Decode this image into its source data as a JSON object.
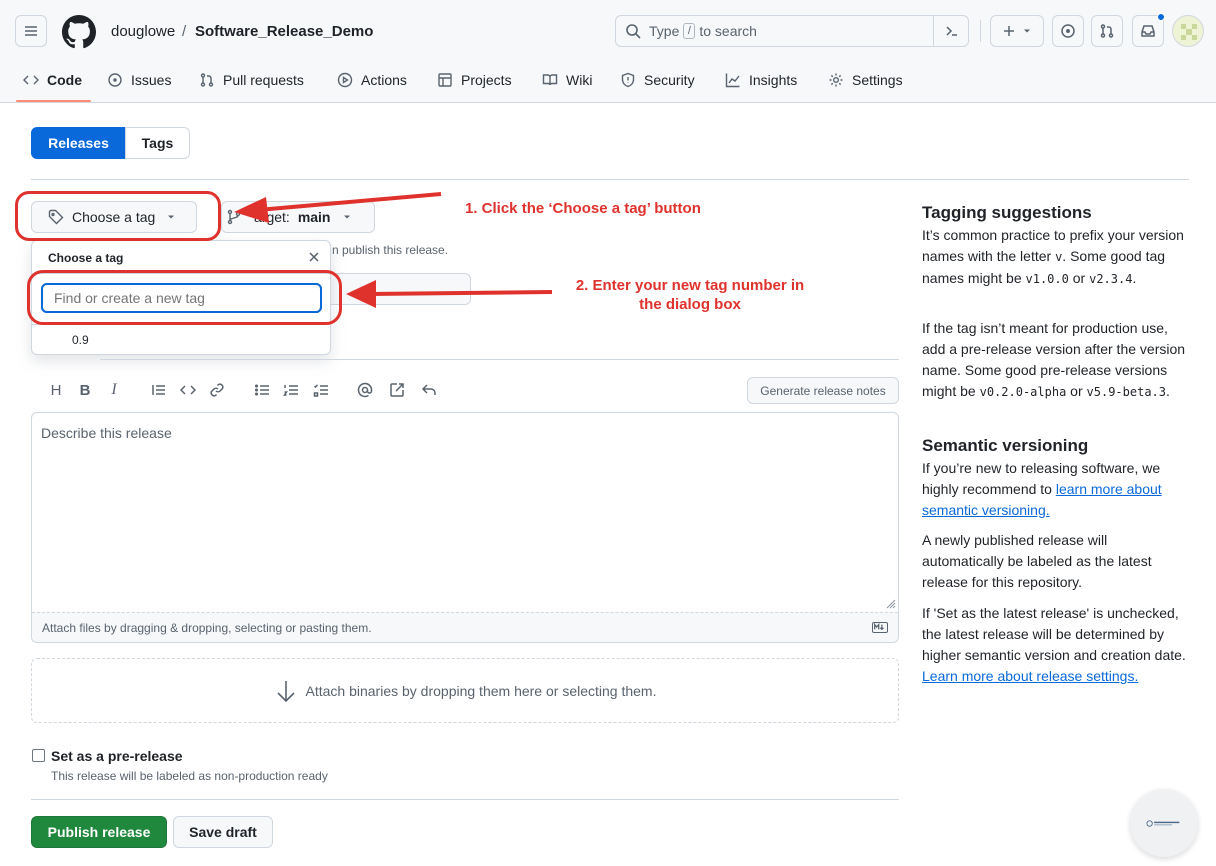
{
  "header": {
    "owner": "douglowe",
    "separator": "/",
    "repo": "Software_Release_Demo",
    "search": {
      "prefix": "Type",
      "slash": "/",
      "suffix": "to search"
    }
  },
  "nav": {
    "items": [
      {
        "label": "Code",
        "icon": "code-icon"
      },
      {
        "label": "Issues",
        "icon": "issue-icon"
      },
      {
        "label": "Pull requests",
        "icon": "pull-request-icon"
      },
      {
        "label": "Actions",
        "icon": "play-icon"
      },
      {
        "label": "Projects",
        "icon": "table-icon"
      },
      {
        "label": "Wiki",
        "icon": "book-icon"
      },
      {
        "label": "Security",
        "icon": "shield-icon"
      },
      {
        "label": "Insights",
        "icon": "graph-icon"
      },
      {
        "label": "Settings",
        "icon": "gear-icon"
      }
    ]
  },
  "tabs": {
    "releases": "Releases",
    "tags": "Tags"
  },
  "tag_button": {
    "label": "Choose a tag"
  },
  "target_button": {
    "label": "arget:",
    "branch": "main"
  },
  "hint_text": "n publish this release.",
  "dropdown": {
    "title": "Choose a tag",
    "placeholder": "Find or create a new tag",
    "options": [
      "0.9"
    ]
  },
  "annotations": {
    "step1": "1. Click the ‘Choose a tag’ button",
    "step2_line1": "2. Enter your new tag number in",
    "step2_line2": "the dialog box"
  },
  "editor": {
    "generate_notes": "Generate release notes",
    "placeholder": "Describe this release",
    "attach_hint": "Attach files by dragging & dropping, selecting or pasting them."
  },
  "binaries": {
    "text": "Attach binaries by dropping them here or selecting them."
  },
  "prerelease": {
    "label": "Set as a pre-release",
    "hint": "This release will be labeled as non-production ready"
  },
  "actions": {
    "publish": "Publish release",
    "draft": "Save draft"
  },
  "sidebar": {
    "tagging_title": "Tagging suggestions",
    "tagging_p1_a": "It’s common practice to prefix your version names with the letter ",
    "tagging_p1_v": "v",
    "tagging_p1_b": ". Some good tag names might be ",
    "tagging_p1_c1": "v1.0.0",
    "tagging_p1_or": " or ",
    "tagging_p1_c2": "v2.3.4",
    "tagging_p1_end": ".",
    "tagging_p2_a": "If the tag isn’t meant for production use, add a pre-release version after the version name. Some good pre-release versions might be ",
    "tagging_p2_c1": "v0.2.0-alpha",
    "tagging_p2_or": " or ",
    "tagging_p2_c2": "v5.9-beta.3",
    "tagging_p2_end": ".",
    "semver_title": "Semantic versioning",
    "semver_p1_a": "If you’re new to releasing software, we highly recommend to ",
    "semver_p1_link": "learn more about semantic versioning.",
    "semver_p2": "A newly published release will automatically be labeled as the latest release for this repository.",
    "semver_p3_a": "If 'Set as the latest release' is unchecked, the latest release will be determined by higher semantic version and creation date. ",
    "semver_p3_link": "Learn more about release settings."
  },
  "colors": {
    "primary_blue": "#0969da",
    "publish_green": "#1f883d",
    "annotation_red": "#e0322d",
    "nav_underline": "#fd8c73"
  }
}
